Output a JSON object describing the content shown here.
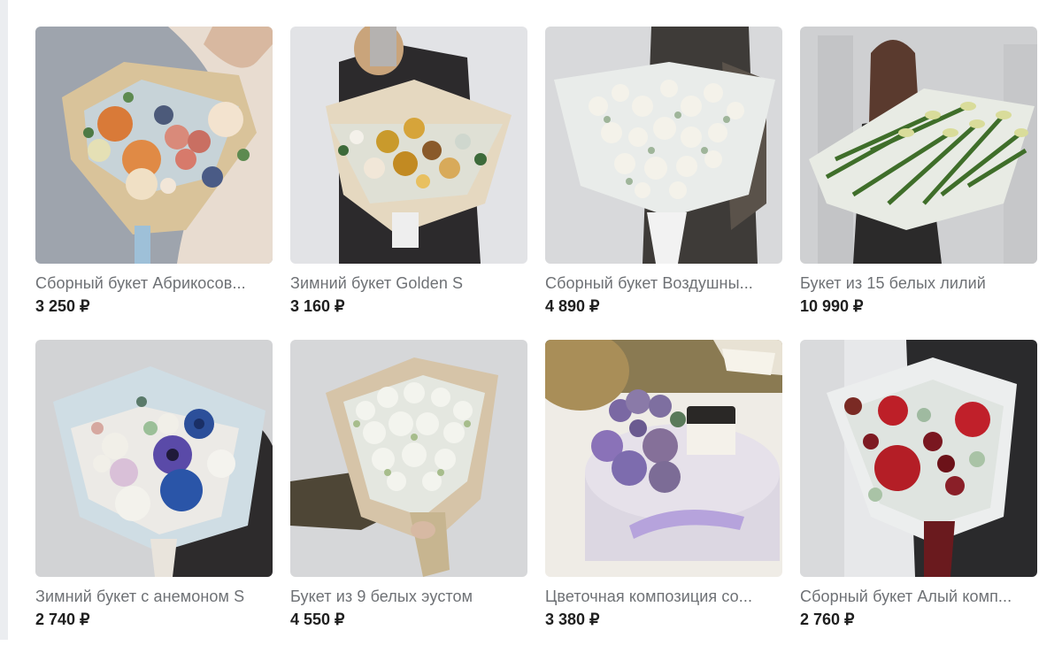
{
  "products": [
    {
      "title": "Сборный букет Абрикосов...",
      "price": "3 250 ₽"
    },
    {
      "title": "Зимний букет Golden S",
      "price": "3 160 ₽"
    },
    {
      "title": "Сборный букет Воздушны...",
      "price": "4 890 ₽"
    },
    {
      "title": "Букет из 15 белых лилий",
      "price": "10 990 ₽"
    },
    {
      "title": "Зимний букет с анемоном S",
      "price": "2 740 ₽"
    },
    {
      "title": "Букет из 9 белых эустом",
      "price": "4 550 ₽"
    },
    {
      "title": "Цветочная композиция со...",
      "price": "3 380 ₽"
    },
    {
      "title": "Сборный букет Алый комп...",
      "price": "2 760 ₽"
    }
  ]
}
